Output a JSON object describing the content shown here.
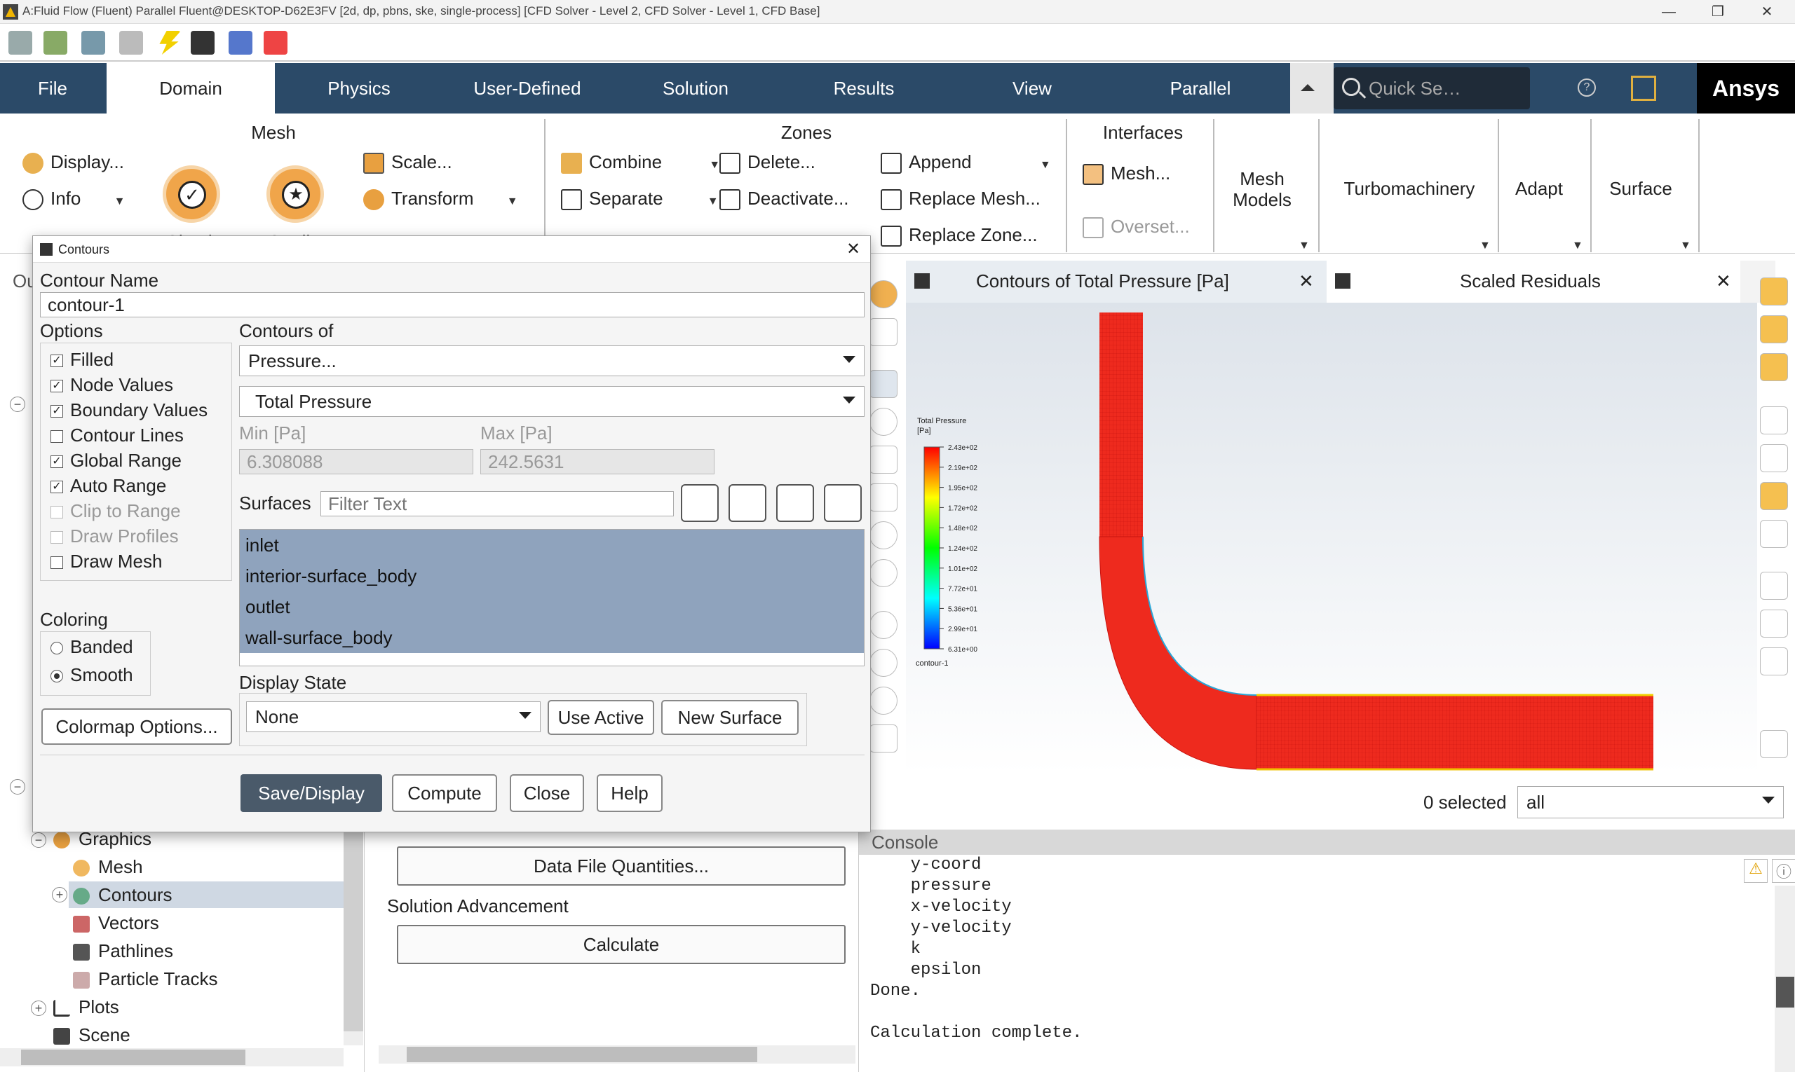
{
  "window": {
    "title": "A:Fluid Flow (Fluent) Parallel Fluent@DESKTOP-D62E3FV  [2d, dp, pbns, ske, single-process] [CFD Solver - Level 2, CFD Solver - Level 1, CFD Base]",
    "minimize": "—",
    "maximize": "❐",
    "close": "✕"
  },
  "ribbon_tabs": [
    "File",
    "Domain",
    "Physics",
    "User-Defined",
    "Solution",
    "Results",
    "View",
    "Parallel"
  ],
  "search": {
    "placeholder": "Quick Se…",
    "logo": "Ansys"
  },
  "ribbon": {
    "mesh": {
      "title": "Mesh",
      "display": "Display...",
      "info": "Info",
      "check": "Check",
      "quality": "Quality",
      "scale": "Scale...",
      "transform": "Transform"
    },
    "zones": {
      "title": "Zones",
      "combine": "Combine",
      "separate": "Separate",
      "delete": "Delete...",
      "deactivate": "Deactivate...",
      "append": "Append",
      "replace_mesh": "Replace Mesh...",
      "replace_zone": "Replace Zone..."
    },
    "interfaces": {
      "title": "Interfaces",
      "mesh": "Mesh...",
      "overset": "Overset..."
    },
    "mesh_models": "Mesh Models",
    "turbomachinery": "Turbomachinery",
    "adapt": "Adapt",
    "surface": "Surface"
  },
  "tree": {
    "partial_label": "Ou",
    "items": [
      {
        "label": "Graphics"
      },
      {
        "label": "Mesh"
      },
      {
        "label": "Contours"
      },
      {
        "label": "Vectors"
      },
      {
        "label": "Pathlines"
      },
      {
        "label": "Particle Tracks"
      },
      {
        "label": "Plots"
      },
      {
        "label": "Scene"
      }
    ]
  },
  "taskpage": {
    "data_file_btn": "Data File Quantities...",
    "solution_advancement": "Solution Advancement",
    "calculate_btn": "Calculate"
  },
  "dialog": {
    "title": "Contours",
    "contour_name_label": "Contour Name",
    "contour_name": "contour-1",
    "options_label": "Options",
    "options": [
      {
        "label": "Filled",
        "checked": true,
        "disabled": false
      },
      {
        "label": "Node Values",
        "checked": true,
        "disabled": false
      },
      {
        "label": "Boundary Values",
        "checked": true,
        "disabled": false
      },
      {
        "label": "Contour Lines",
        "checked": false,
        "disabled": false
      },
      {
        "label": "Global Range",
        "checked": true,
        "disabled": false
      },
      {
        "label": "Auto Range",
        "checked": true,
        "disabled": false
      },
      {
        "label": "Clip to Range",
        "checked": false,
        "disabled": true
      },
      {
        "label": "Draw Profiles",
        "checked": false,
        "disabled": true
      },
      {
        "label": "Draw Mesh",
        "checked": false,
        "disabled": false
      }
    ],
    "coloring_label": "Coloring",
    "coloring": [
      {
        "label": "Banded",
        "selected": false
      },
      {
        "label": "Smooth",
        "selected": true
      }
    ],
    "colormap_btn": "Colormap Options...",
    "contours_of_label": "Contours of",
    "contours_of": "Pressure...",
    "contours_sub": "Total Pressure",
    "min_label": "Min [Pa]",
    "max_label": "Max [Pa]",
    "min_value": "6.308088",
    "max_value": "242.5631",
    "surfaces_label": "Surfaces",
    "filter_placeholder": "Filter Text",
    "surfaces": [
      "inlet",
      "interior-surface_body",
      "outlet",
      "wall-surface_body"
    ],
    "display_state_label": "Display State",
    "display_state": "None",
    "use_active_btn": "Use Active",
    "new_surface_btn": "New Surface",
    "buttons": {
      "save_display": "Save/Display",
      "compute": "Compute",
      "close": "Close",
      "help": "Help"
    }
  },
  "graphics": {
    "tab1": "Contours of Total Pressure [Pa]",
    "tab2": "Scaled Residuals",
    "legend_title": "Total Pressure",
    "legend_unit": "[Pa]",
    "legend_values": [
      "2.43e+02",
      "2.19e+02",
      "1.95e+02",
      "1.72e+02",
      "1.48e+02",
      "1.24e+02",
      "1.01e+02",
      "7.72e+01",
      "5.36e+01",
      "2.99e+01",
      "6.31e+00"
    ],
    "legend_footer": "contour-1",
    "selected_label": "0 selected",
    "selection_filter": "all"
  },
  "console": {
    "title": "Console",
    "lines": [
      "    y-coord",
      "    pressure",
      "    x-velocity",
      "    y-velocity",
      "    k",
      "    epsilon",
      "Done.",
      "",
      "Calculation complete."
    ]
  },
  "colors": {
    "ribbon_bar": "#2b4a68",
    "selection": "#8fa3bd",
    "accent_btn": "#4a5a6a"
  }
}
